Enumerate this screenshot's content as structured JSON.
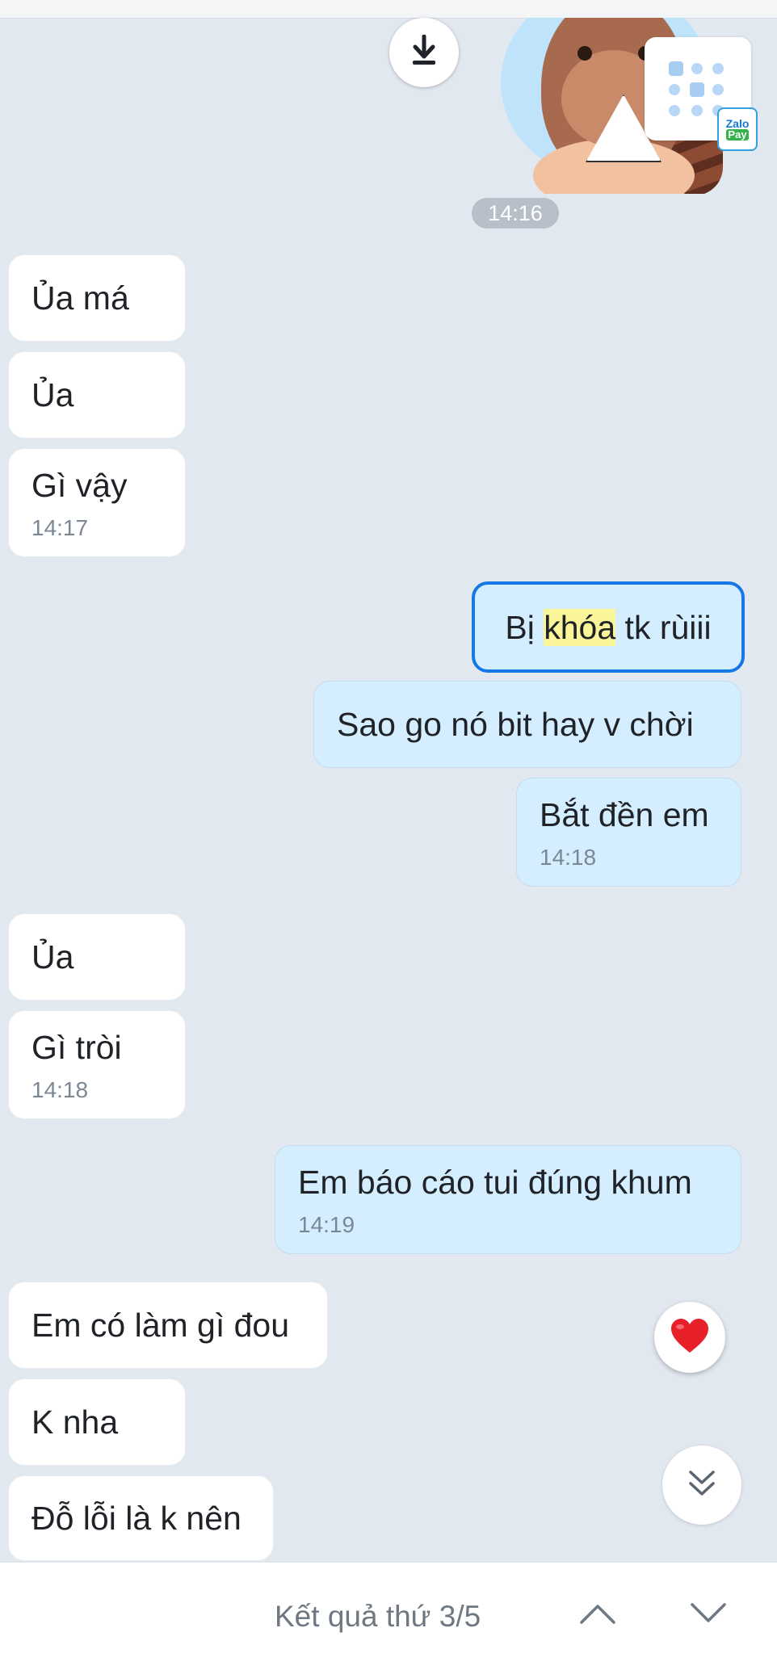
{
  "colors": {
    "background": "#e2e8f0",
    "incoming_bubble": "#ffffff",
    "outgoing_bubble": "#d5eeff",
    "selected_border": "#1479e4",
    "highlight": "#fbf59a",
    "timestamp": "#7c8794"
  },
  "header": {
    "download_icon": "download-icon",
    "zalopay_logo": {
      "line1": "Zalo",
      "line2": "Pay"
    }
  },
  "time_divider": "14:16",
  "messages": [
    {
      "side": "in",
      "text": "Ủa má"
    },
    {
      "side": "in",
      "text": "Ủa"
    },
    {
      "side": "in",
      "text": "Gì vậy",
      "time": "14:17"
    },
    {
      "side": "out",
      "text_before": "Bị ",
      "text_highlight": "khóa",
      "text_after": " tk rùiii",
      "selected": true
    },
    {
      "side": "out",
      "text": "Sao go nó bit hay v chời"
    },
    {
      "side": "out",
      "text": "Bắt đền em",
      "time": "14:18"
    },
    {
      "side": "in",
      "text": "Ủa"
    },
    {
      "side": "in",
      "text": "Gì tròi",
      "time": "14:18"
    },
    {
      "side": "out",
      "text": "Em báo cáo tui đúng khum",
      "time": "14:19"
    },
    {
      "side": "in",
      "text": "Em có làm gì đou"
    },
    {
      "side": "in",
      "text": "K nha"
    },
    {
      "side": "in",
      "text": "Đỗ lỗi là k nên"
    }
  ],
  "reaction_icon": "heart-icon",
  "scroll_down_icon": "double-chevron-down-icon",
  "search": {
    "result_label": "Kết quả thứ 3/5",
    "prev_icon": "chevron-up-icon",
    "next_icon": "chevron-down-icon"
  }
}
